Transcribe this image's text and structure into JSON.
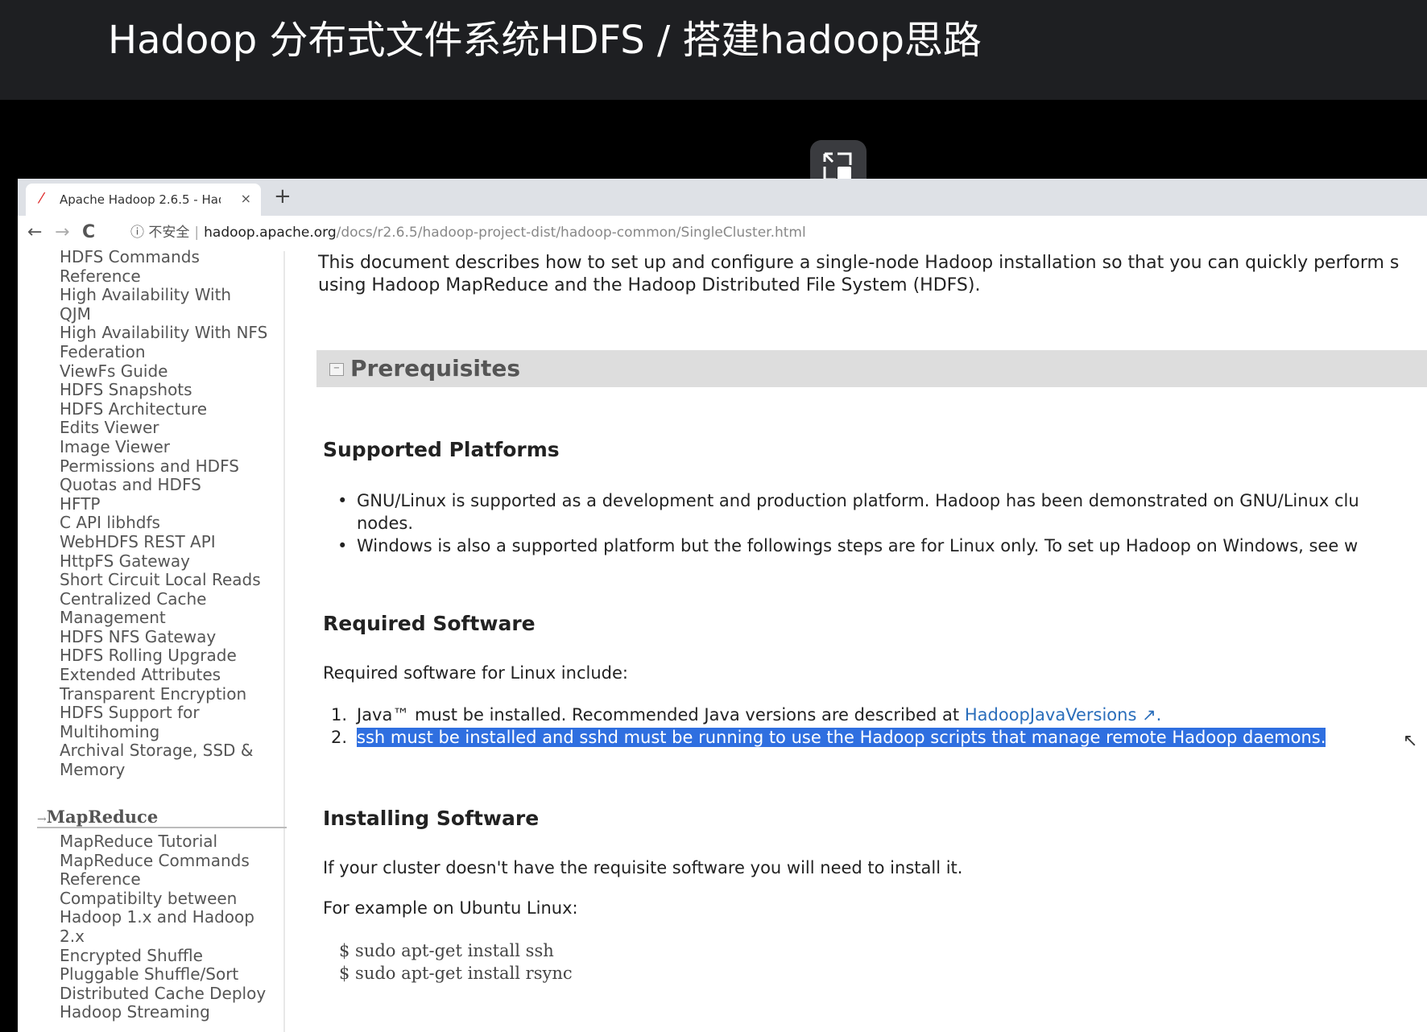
{
  "video_title": "Hadoop 分布式文件系统HDFS / 搭建hadoop思路",
  "browser": {
    "tab_title": "Apache Hadoop 2.6.5 - Hado",
    "tab_close": "×",
    "new_tab": "+",
    "back": "←",
    "forward": "→",
    "reload": "C",
    "security_label": "ⓘ 不安全",
    "url_host": "hadoop.apache.org",
    "url_path": "/docs/r2.6.5/hadoop-project-dist/hadoop-common/SingleCluster.html"
  },
  "sidebar": {
    "hdfs_items": [
      "HDFS Commands",
      "Reference",
      "High Availability With",
      "QJM",
      "High Availability With NFS",
      "Federation",
      "ViewFs Guide",
      "HDFS Snapshots",
      "HDFS Architecture",
      "Edits Viewer",
      "Image Viewer",
      "Permissions and HDFS",
      "Quotas and HDFS",
      "HFTP",
      "C API libhdfs",
      "WebHDFS REST API",
      "HttpFS Gateway",
      "Short Circuit Local Reads",
      "Centralized Cache",
      "Management",
      "HDFS NFS Gateway",
      "HDFS Rolling Upgrade",
      "Extended Attributes",
      "Transparent Encryption",
      "HDFS Support for",
      "Multihoming",
      "Archival Storage, SSD &",
      "Memory"
    ],
    "mapreduce_heading": "MapReduce",
    "mapreduce_items": [
      "MapReduce Tutorial",
      "MapReduce Commands",
      "Reference",
      "Compatibilty between",
      "Hadoop 1.x and Hadoop",
      "2.x",
      "Encrypted Shuffle",
      "Pluggable Shuffle/Sort",
      "Distributed Cache Deploy",
      "Hadoop Streaming"
    ]
  },
  "content": {
    "intro_line1": "This document describes how to set up and configure a single-node Hadoop installation so that you can quickly perform s",
    "intro_line2": "using Hadoop MapReduce and the Hadoop Distributed File System (HDFS).",
    "prerequisites_heading": "Prerequisites",
    "supported_platforms_heading": "Supported Platforms",
    "platform_bullet1_line1": "GNU/Linux is supported as a development and production platform. Hadoop has been demonstrated on GNU/Linux clu",
    "platform_bullet1_line2": "nodes.",
    "platform_bullet2": "Windows is also a supported platform but the followings steps are for Linux only. To set up Hadoop on Windows, see w",
    "required_software_heading": "Required Software",
    "required_software_intro": "Required software for Linux include:",
    "req_item1_text": "Java™ must be installed. Recommended Java versions are described at ",
    "req_item1_link": "HadoopJavaVersions",
    "req_item1_ext": " ↗.",
    "req_item2_selected": "ssh must be installed and sshd must be running to use the Hadoop scripts that manage remote Hadoop daemons.",
    "installing_software_heading": "Installing Software",
    "install_text1": "If your cluster doesn't have the requisite software you will need to install it.",
    "install_text2": "For example on Ubuntu Linux:",
    "code_line1": "$ sudo apt-get install ssh",
    "code_line2": "$ sudo apt-get install rsync"
  }
}
